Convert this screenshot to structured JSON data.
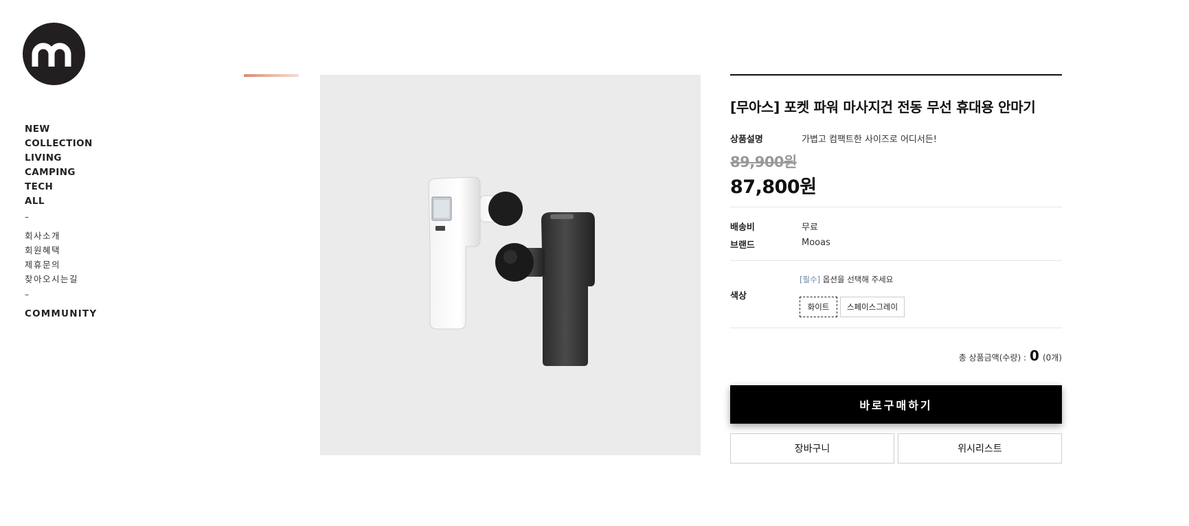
{
  "brand_logo": {
    "icon": "m-logo-icon",
    "color": "#231f20"
  },
  "nav": {
    "main": [
      "NEW",
      "COLLECTION",
      "LIVING",
      "CAMPING",
      "TECH",
      "ALL"
    ],
    "separator": "–",
    "sub": [
      "회사소개",
      "회원혜택",
      "제휴문의",
      "찾아오시는길"
    ],
    "community": "COMMUNITY"
  },
  "product": {
    "title": "[무아스] 포켓 파워 마사지건 전동 무선 휴대용 안마기",
    "description_label": "상품설명",
    "description": "가볍고 컴팩트한 사이즈로 어디서든!",
    "original_price": "89,900원",
    "sale_price": "87,800원",
    "shipping_label": "배송비",
    "shipping": "무료",
    "brand_label": "브랜드",
    "brand": "Mooas",
    "option_label": "색상",
    "option_required": "[필수]",
    "option_note": " 옵션을 선택해 주세요",
    "options": [
      "화이트",
      "스페이스그레이"
    ],
    "selected_option": "화이트",
    "total_label": "총 상품금액(수량) :",
    "total_amount": "0",
    "total_count": "(0개)"
  },
  "buttons": {
    "buy_now": "바로구매하기",
    "cart": "장바구니",
    "wishlist": "위시리스트"
  },
  "colors": {
    "accent": "#000000",
    "image_bg": "#ebebeb",
    "strike_price": "#999999",
    "required_tag": "#6a84a8"
  }
}
